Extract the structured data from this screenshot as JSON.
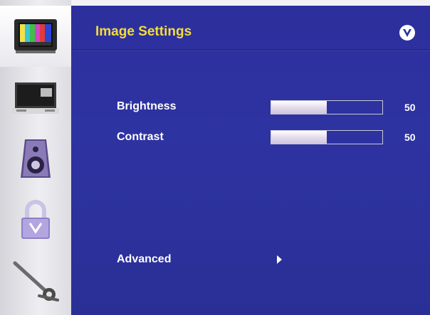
{
  "menu": {
    "title": "Image Settings",
    "sidebar": [
      {
        "name": "picture-icon",
        "active": true
      },
      {
        "name": "tv-input-icon",
        "active": false
      },
      {
        "name": "speaker-icon",
        "active": false
      },
      {
        "name": "lock-icon",
        "active": false
      },
      {
        "name": "wrench-icon",
        "active": false
      }
    ],
    "items": [
      {
        "label": "Brightness",
        "value": "50",
        "level": 50,
        "max": 100
      },
      {
        "label": "Contrast",
        "value": "50",
        "level": 50,
        "max": 100
      },
      {
        "label": "Advanced"
      }
    ]
  },
  "colors": {
    "title": "#f4dc3c",
    "panel": "#2e33a2",
    "text": "#ffffff"
  }
}
